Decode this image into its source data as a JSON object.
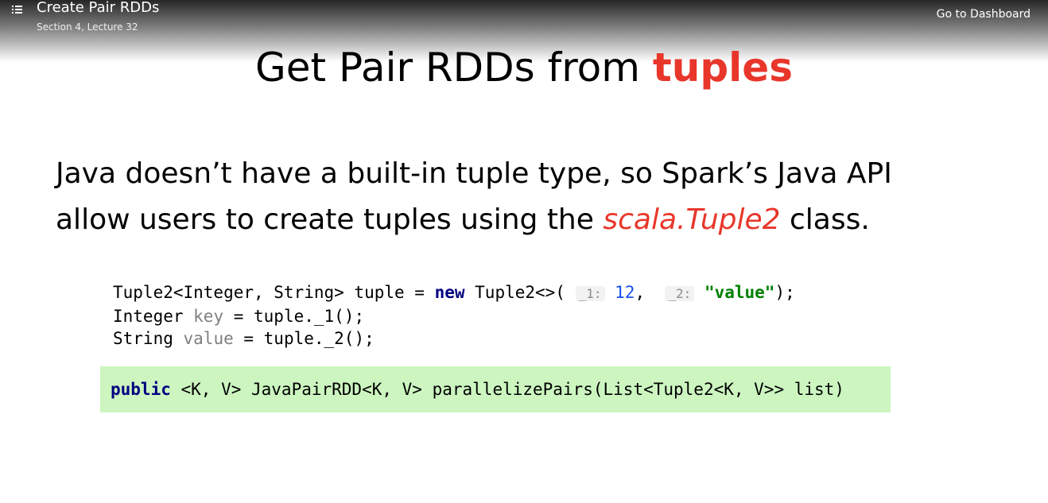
{
  "header": {
    "menu_icon": "list-icon",
    "title": "Create Pair RDDs",
    "subtitle": "Section 4, Lecture 32",
    "dashboard_link": "Go to Dashboard"
  },
  "slide": {
    "title_prefix": "Get Pair RDDs from ",
    "title_accent": "tuples",
    "body_line1": "Java doesn’t have a built-in tuple type, so Spark’s Java API",
    "body_line2_prefix": "allow users to create tuples using the ",
    "body_line2_accent": "scala.Tuple2",
    "body_line2_suffix": " class.",
    "code": {
      "l1_a": "Tuple2<Integer, String> tuple = ",
      "l1_kw": "new",
      "l1_b": " Tuple2<>( ",
      "l1_hint1": "_1:",
      "l1_num": "12",
      "l1_c": ",  ",
      "l1_hint2": "_2:",
      "l1_str": "\"value\"",
      "l1_d": ");",
      "l2_a": "Integer ",
      "l2_dim": "key",
      "l2_b": " = tuple._1();",
      "l3_a": "String ",
      "l3_dim": "value",
      "l3_b": " = tuple._2();"
    },
    "signature": {
      "kw": "public",
      "rest": " <K, V> JavaPairRDD<K, V> parallelizePairs(List<Tuple2<K, V>> list)"
    }
  },
  "colors": {
    "accent": "#e8362b",
    "signature_bg": "#ccf5c0",
    "keyword": "#000080",
    "number": "#1750eb",
    "string": "#008000"
  }
}
